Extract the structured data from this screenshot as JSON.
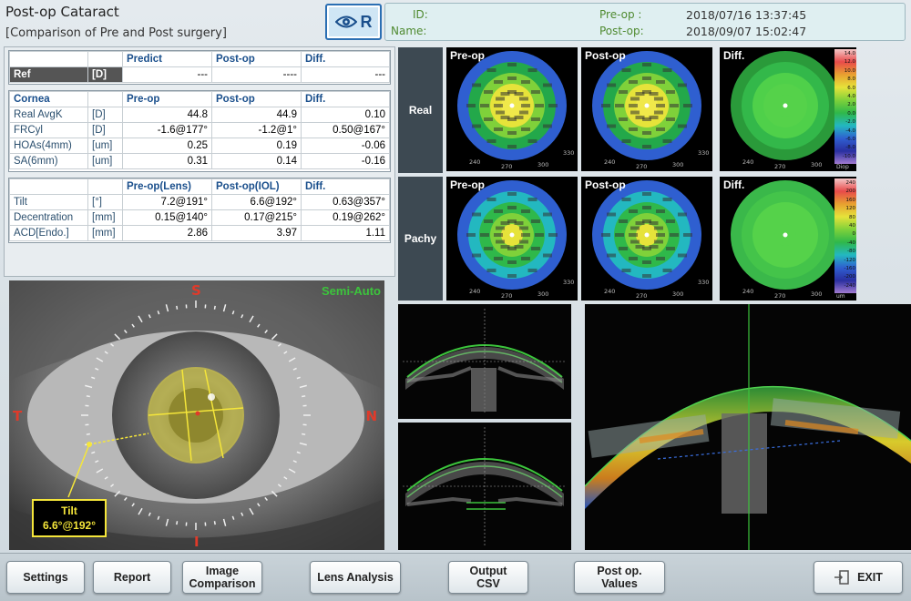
{
  "header": {
    "title": "Post-op Cataract",
    "subtitle": "[Comparison of Pre and Post surgery]",
    "eye_label": "R",
    "id_label": "ID:",
    "name_label": "Name:",
    "preop_label": "Pre-op :",
    "preop_date": "2018/07/16 13:37:45",
    "postop_label": "Post-op:",
    "postop_date": "2018/09/07 15:02:47"
  },
  "ref_table": {
    "headers": [
      "",
      "",
      "Predict",
      "Post-op",
      "Diff."
    ],
    "row": {
      "name": "Ref",
      "unit": "[D]",
      "predict": "---",
      "postop": "----",
      "diff": "---"
    }
  },
  "cornea_table": {
    "headers": [
      "Cornea",
      "",
      "Pre-op",
      "Post-op",
      "Diff."
    ],
    "rows": [
      {
        "name": "Real AvgK",
        "unit": "[D]",
        "pre": "44.8",
        "post": "44.9",
        "diff": "0.10"
      },
      {
        "name": "FRCyl",
        "unit": "[D]",
        "pre": "-1.6@177°",
        "post": "-1.2@1°",
        "diff": "0.50@167°"
      },
      {
        "name": "HOAs(4mm)",
        "unit": "[um]",
        "pre": "0.25",
        "post": "0.19",
        "diff": "-0.06"
      },
      {
        "name": "SA(6mm)",
        "unit": "[um]",
        "pre": "0.31",
        "post": "0.14",
        "diff": "-0.16"
      }
    ]
  },
  "lens_table": {
    "headers": [
      "",
      "",
      "Pre-op(Lens)",
      "Post-op(IOL)",
      "Diff."
    ],
    "rows": [
      {
        "name": "Tilt",
        "unit": "[°]",
        "pre": "7.2@191°",
        "post": "6.6@192°",
        "diff": "0.63@357°"
      },
      {
        "name": "Decentration",
        "unit": "[mm]",
        "pre": "0.15@140°",
        "post": "0.17@215°",
        "diff": "0.19@262°"
      },
      {
        "name": "ACD[Endo.]",
        "unit": "[mm]",
        "pre": "2.86",
        "post": "3.97",
        "diff": "1.11"
      }
    ]
  },
  "eye_image": {
    "mode": "Semi-Auto",
    "dir_top": "S",
    "dir_bottom": "I",
    "dir_left": "T",
    "dir_right": "N",
    "tilt_label": "Tilt",
    "tilt_value": "6.6°@192°"
  },
  "maps": {
    "row_labels": [
      "Real",
      "Pachy"
    ],
    "col_labels": [
      "Pre-op",
      "Post-op",
      "Diff."
    ],
    "scale_units": [
      "Diop",
      "um"
    ],
    "angle_labels": [
      "240",
      "270",
      "300",
      "330"
    ],
    "real_scale": [
      "14.0",
      "12.0",
      "10.0",
      "8.0",
      "6.0",
      "4.0",
      "2.0",
      "0.0",
      "-2.0",
      "-4.0",
      "-6.0",
      "-8.0",
      "-10.0"
    ],
    "pachy_scale": [
      "240",
      "200",
      "160",
      "120",
      "80",
      "40",
      "0",
      "-40",
      "-80",
      "-120",
      "-160",
      "-200",
      "-240"
    ]
  },
  "colors": {
    "accent": "#1a4f8c",
    "green_label": "#4f8a30",
    "semi_auto": "#3cc43c",
    "direction": "#e03a2a",
    "tilt_yellow": "#f5e63a"
  },
  "buttons": {
    "settings": "Settings",
    "report": "Report",
    "image_comparison_1": "Image",
    "image_comparison_2": "Comparison",
    "lens_analysis": "Lens Analysis",
    "output_csv_1": "Output",
    "output_csv_2": "CSV",
    "postop_values_1": "Post op.",
    "postop_values_2": "Values",
    "exit": "EXIT"
  }
}
